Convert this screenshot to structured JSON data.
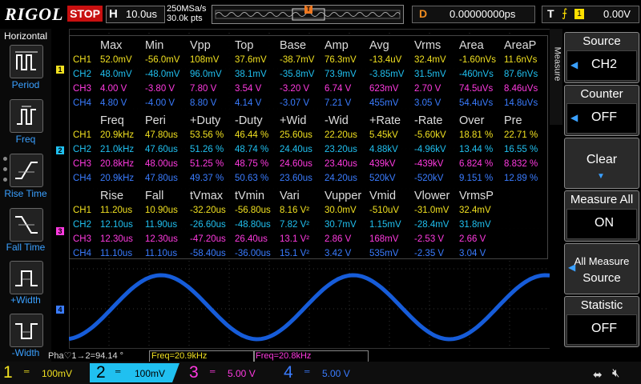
{
  "brand": {
    "logo": "RIGOL"
  },
  "status": {
    "run_state": "STOP"
  },
  "horizontal": {
    "label": "H",
    "timebase": "10.0us",
    "sample_rate": "250MSa/s",
    "mem_depth": "30.0k pts"
  },
  "trigger_marker": "T",
  "delay": {
    "label": "D",
    "value": "0.00000000ps"
  },
  "trigger": {
    "label": "T",
    "source": "1",
    "level": "0.00V",
    "edge_icon": "rising-edge-icon"
  },
  "left_menu": {
    "title": "Horizontal",
    "items": [
      {
        "label": "Period",
        "icon": "period-icon",
        "selected": false
      },
      {
        "label": "Freq",
        "icon": "freq-icon",
        "selected": false
      },
      {
        "label": "Rise Time",
        "icon": "rise-time-icon",
        "selected": false
      },
      {
        "label": "Fall Time",
        "icon": "fall-time-icon",
        "selected": false
      },
      {
        "label": "+Width",
        "icon": "positive-width-icon",
        "selected": false
      },
      {
        "label": "-Width",
        "icon": "negative-width-icon",
        "selected": false
      }
    ]
  },
  "channel_markers": [
    "1",
    "2",
    "3",
    "4"
  ],
  "measure_table": {
    "sections": [
      {
        "headers": [
          "Max",
          "Min",
          "Vpp",
          "Top",
          "Base",
          "Amp",
          "Avg",
          "Vrms",
          "Area",
          "AreaP"
        ],
        "rows": [
          {
            "ch": "CH1",
            "values": [
              "52.0mV",
              "-56.0mV",
              "108mV",
              "37.6mV",
              "-38.7mV",
              "76.3mV",
              "-13.4uV",
              "32.4mV",
              "-1.60nVs",
              "11.6nVs"
            ]
          },
          {
            "ch": "CH2",
            "values": [
              "48.0mV",
              "-48.0mV",
              "96.0mV",
              "38.1mV",
              "-35.8mV",
              "73.9mV",
              "-3.85mV",
              "31.5mV",
              "-460nVs",
              "87.6nVs"
            ]
          },
          {
            "ch": "CH3",
            "values": [
              "4.00 V",
              "-3.80 V",
              "7.80 V",
              "3.54 V",
              "-3.20 V",
              "6.74 V",
              "623mV",
              "2.70 V",
              "74.5uVs",
              "8.46uVs"
            ]
          },
          {
            "ch": "CH4",
            "values": [
              "4.80 V",
              "-4.00 V",
              "8.80 V",
              "4.14 V",
              "-3.07 V",
              "7.21 V",
              "455mV",
              "3.05 V",
              "54.4uVs",
              "14.8uVs"
            ]
          }
        ]
      },
      {
        "headers": [
          "Freq",
          "Peri",
          "+Duty",
          "-Duty",
          "+Wid",
          "-Wid",
          "+Rate",
          "-Rate",
          "Over",
          "Pre"
        ],
        "rows": [
          {
            "ch": "CH1",
            "values": [
              "20.9kHz",
              "47.80us",
              "53.56 %",
              "46.44 %",
              "25.60us",
              "22.20us",
              "5.45kV",
              "-5.60kV",
              "18.81 %",
              "22.71 %"
            ]
          },
          {
            "ch": "CH2",
            "values": [
              "21.0kHz",
              "47.60us",
              "51.26 %",
              "48.74 %",
              "24.40us",
              "23.20us",
              "4.88kV",
              "-4.96kV",
              "13.44 %",
              "16.55 %"
            ]
          },
          {
            "ch": "CH3",
            "values": [
              "20.8kHz",
              "48.00us",
              "51.25 %",
              "48.75 %",
              "24.60us",
              "23.40us",
              "439kV",
              "-439kV",
              "6.824 %",
              "8.832 %"
            ]
          },
          {
            "ch": "CH4",
            "values": [
              "20.9kHz",
              "47.80us",
              "49.37 %",
              "50.63 %",
              "23.60us",
              "24.20us",
              "520kV",
              "-520kV",
              "9.151 %",
              "12.89 %"
            ]
          }
        ]
      },
      {
        "headers": [
          "Rise",
          "Fall",
          "tVmax",
          "tVmin",
          "Vari",
          "Vupper",
          "Vmid",
          "Vlower",
          "VrmsP",
          ""
        ],
        "rows": [
          {
            "ch": "CH1",
            "values": [
              "11.20us",
              "10.90us",
              "-32.20us",
              "-56.80us",
              "8.16 V²",
              "30.0mV",
              "-510uV",
              "-31.0mV",
              "32.4mV",
              ""
            ]
          },
          {
            "ch": "CH2",
            "values": [
              "12.10us",
              "11.90us",
              "-26.60us",
              "-48.80us",
              "7.82 V²",
              "30.7mV",
              "1.15mV",
              "-28.4mV",
              "31.8mV",
              ""
            ]
          },
          {
            "ch": "CH3",
            "values": [
              "12.30us",
              "12.30us",
              "-47.20us",
              "26.40us",
              "13.1 V²",
              "2.86 V",
              "168mV",
              "-2.53 V",
              "2.66 V",
              ""
            ]
          },
          {
            "ch": "CH4",
            "values": [
              "11.10us",
              "11.10us",
              "-58.40us",
              "-36.00us",
              "15.1 V²",
              "3.42 V",
              "535mV",
              "-2.35 V",
              "3.04 V",
              ""
            ]
          }
        ]
      }
    ]
  },
  "readouts": {
    "phase": "Pha♡1→2=94.14 °",
    "freq_a": "Freq=20.9kHz",
    "freq_b": "Freq=20.8kHz"
  },
  "channels": [
    {
      "num": "1",
      "coupling": "DC",
      "scale": "100mV",
      "color": "#f0e020"
    },
    {
      "num": "2",
      "coupling": "DC",
      "scale": "100mV",
      "color": "#20c0f0"
    },
    {
      "num": "3",
      "coupling": "DC",
      "scale": "5.00 V",
      "color": "#ff3ae0"
    },
    {
      "num": "4",
      "coupling": "DC",
      "scale": "5.00 V",
      "color": "#3a7cff"
    }
  ],
  "right_menu": {
    "tab": "Measure",
    "source": {
      "title": "Source",
      "value": "CH2"
    },
    "counter": {
      "title": "Counter",
      "value": "OFF"
    },
    "clear": {
      "title": "Clear"
    },
    "measure_all": {
      "title": "Measure All",
      "value": "ON"
    },
    "all_measure_source": {
      "title_line1": "All Measure",
      "title_line2": "Source"
    },
    "statistic": {
      "title": "Statistic",
      "value": "OFF"
    }
  },
  "status_icons": {
    "usb": "usb-icon",
    "speaker": "speaker-muted-icon"
  },
  "colors": {
    "ch1": "#f0e020",
    "ch2": "#20c0f0",
    "ch3": "#ff3ae0",
    "ch4": "#3a7cff",
    "stop": "#c81010",
    "delay": "#f08c20"
  }
}
